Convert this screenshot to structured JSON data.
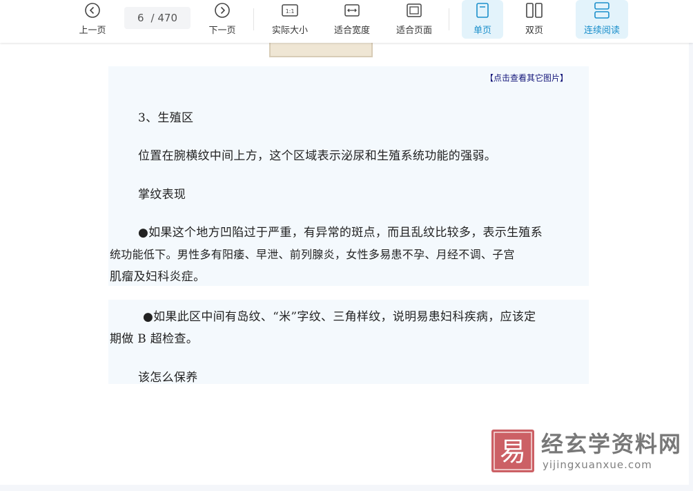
{
  "toolbar": {
    "prev_label": "上一页",
    "next_label": "下一页",
    "page_current": "6",
    "page_total": "/ 470",
    "actual_size_label": "实际大小",
    "fit_width_label": "适合宽度",
    "fit_page_label": "适合页面",
    "single_page_label": "单页",
    "double_page_label": "双页",
    "continuous_label": "连续阅读",
    "active_view": "single_page",
    "accent_color": "#1a8fcb"
  },
  "document": {
    "image_link": "【点击查看其它图片】",
    "section_heading": "3、生殖区",
    "para_position": "位置在腕横纹中间上方，这个区域表示泌尿和生殖系统功能的强弱。",
    "sub_heading": "掌纹表现",
    "bullet1_line1": "●如果这个地方凹陷过于严重，有异常的斑点，而且乱纹比较多，表示生殖系",
    "bullet1_line2": "统功能低下。男性多有阳痿、早泄、前列腺炎，女性多易患不孕、月经不调、子宫",
    "bullet1_line3": "肌瘤及妇科炎症。",
    "bullet2_line1": "●如果此区中间有岛纹、“米”字纹、三角样纹，说明易患妇科疾病，应该定",
    "bullet2_line2": "期做 B 超检查。",
    "care_heading": "该怎么保养"
  },
  "watermark": {
    "seal_char": "易",
    "site_name": "经玄学资料网",
    "site_url": "yijingxuanxue.com"
  }
}
